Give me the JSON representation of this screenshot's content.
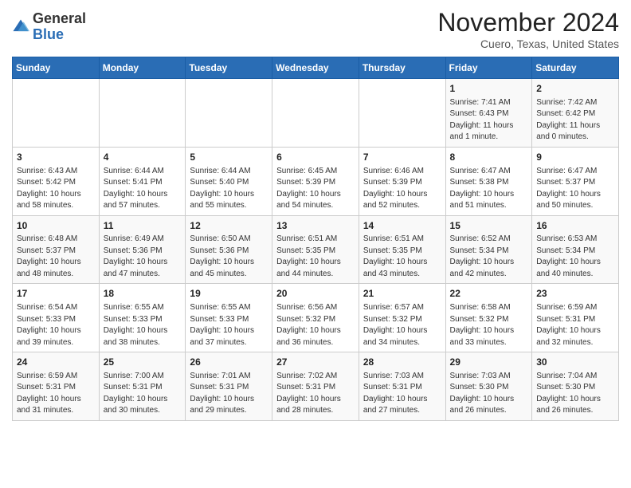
{
  "header": {
    "logo_general": "General",
    "logo_blue": "Blue",
    "month_title": "November 2024",
    "location": "Cuero, Texas, United States"
  },
  "weekdays": [
    "Sunday",
    "Monday",
    "Tuesday",
    "Wednesday",
    "Thursday",
    "Friday",
    "Saturday"
  ],
  "weeks": [
    [
      {
        "day": "",
        "info": ""
      },
      {
        "day": "",
        "info": ""
      },
      {
        "day": "",
        "info": ""
      },
      {
        "day": "",
        "info": ""
      },
      {
        "day": "",
        "info": ""
      },
      {
        "day": "1",
        "info": "Sunrise: 7:41 AM\nSunset: 6:43 PM\nDaylight: 11 hours and 1 minute."
      },
      {
        "day": "2",
        "info": "Sunrise: 7:42 AM\nSunset: 6:42 PM\nDaylight: 11 hours and 0 minutes."
      }
    ],
    [
      {
        "day": "3",
        "info": "Sunrise: 6:43 AM\nSunset: 5:42 PM\nDaylight: 10 hours and 58 minutes."
      },
      {
        "day": "4",
        "info": "Sunrise: 6:44 AM\nSunset: 5:41 PM\nDaylight: 10 hours and 57 minutes."
      },
      {
        "day": "5",
        "info": "Sunrise: 6:44 AM\nSunset: 5:40 PM\nDaylight: 10 hours and 55 minutes."
      },
      {
        "day": "6",
        "info": "Sunrise: 6:45 AM\nSunset: 5:39 PM\nDaylight: 10 hours and 54 minutes."
      },
      {
        "day": "7",
        "info": "Sunrise: 6:46 AM\nSunset: 5:39 PM\nDaylight: 10 hours and 52 minutes."
      },
      {
        "day": "8",
        "info": "Sunrise: 6:47 AM\nSunset: 5:38 PM\nDaylight: 10 hours and 51 minutes."
      },
      {
        "day": "9",
        "info": "Sunrise: 6:47 AM\nSunset: 5:37 PM\nDaylight: 10 hours and 50 minutes."
      }
    ],
    [
      {
        "day": "10",
        "info": "Sunrise: 6:48 AM\nSunset: 5:37 PM\nDaylight: 10 hours and 48 minutes."
      },
      {
        "day": "11",
        "info": "Sunrise: 6:49 AM\nSunset: 5:36 PM\nDaylight: 10 hours and 47 minutes."
      },
      {
        "day": "12",
        "info": "Sunrise: 6:50 AM\nSunset: 5:36 PM\nDaylight: 10 hours and 45 minutes."
      },
      {
        "day": "13",
        "info": "Sunrise: 6:51 AM\nSunset: 5:35 PM\nDaylight: 10 hours and 44 minutes."
      },
      {
        "day": "14",
        "info": "Sunrise: 6:51 AM\nSunset: 5:35 PM\nDaylight: 10 hours and 43 minutes."
      },
      {
        "day": "15",
        "info": "Sunrise: 6:52 AM\nSunset: 5:34 PM\nDaylight: 10 hours and 42 minutes."
      },
      {
        "day": "16",
        "info": "Sunrise: 6:53 AM\nSunset: 5:34 PM\nDaylight: 10 hours and 40 minutes."
      }
    ],
    [
      {
        "day": "17",
        "info": "Sunrise: 6:54 AM\nSunset: 5:33 PM\nDaylight: 10 hours and 39 minutes."
      },
      {
        "day": "18",
        "info": "Sunrise: 6:55 AM\nSunset: 5:33 PM\nDaylight: 10 hours and 38 minutes."
      },
      {
        "day": "19",
        "info": "Sunrise: 6:55 AM\nSunset: 5:33 PM\nDaylight: 10 hours and 37 minutes."
      },
      {
        "day": "20",
        "info": "Sunrise: 6:56 AM\nSunset: 5:32 PM\nDaylight: 10 hours and 36 minutes."
      },
      {
        "day": "21",
        "info": "Sunrise: 6:57 AM\nSunset: 5:32 PM\nDaylight: 10 hours and 34 minutes."
      },
      {
        "day": "22",
        "info": "Sunrise: 6:58 AM\nSunset: 5:32 PM\nDaylight: 10 hours and 33 minutes."
      },
      {
        "day": "23",
        "info": "Sunrise: 6:59 AM\nSunset: 5:31 PM\nDaylight: 10 hours and 32 minutes."
      }
    ],
    [
      {
        "day": "24",
        "info": "Sunrise: 6:59 AM\nSunset: 5:31 PM\nDaylight: 10 hours and 31 minutes."
      },
      {
        "day": "25",
        "info": "Sunrise: 7:00 AM\nSunset: 5:31 PM\nDaylight: 10 hours and 30 minutes."
      },
      {
        "day": "26",
        "info": "Sunrise: 7:01 AM\nSunset: 5:31 PM\nDaylight: 10 hours and 29 minutes."
      },
      {
        "day": "27",
        "info": "Sunrise: 7:02 AM\nSunset: 5:31 PM\nDaylight: 10 hours and 28 minutes."
      },
      {
        "day": "28",
        "info": "Sunrise: 7:03 AM\nSunset: 5:31 PM\nDaylight: 10 hours and 27 minutes."
      },
      {
        "day": "29",
        "info": "Sunrise: 7:03 AM\nSunset: 5:30 PM\nDaylight: 10 hours and 26 minutes."
      },
      {
        "day": "30",
        "info": "Sunrise: 7:04 AM\nSunset: 5:30 PM\nDaylight: 10 hours and 26 minutes."
      }
    ]
  ]
}
